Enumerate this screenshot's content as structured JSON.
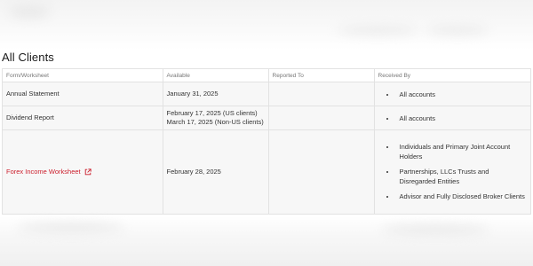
{
  "section": {
    "title": "All Clients"
  },
  "table": {
    "headers": [
      "Form/Worksheet",
      "Available",
      "Reported To",
      "Received By"
    ],
    "rows": [
      {
        "form": "Annual Statement",
        "available": [
          "January 31, 2025"
        ],
        "reported_to": "",
        "received_by": [
          "All accounts"
        ]
      },
      {
        "form": "Dividend Report",
        "available": [
          "February 17, 2025 (US clients)",
          "March 17, 2025 (Non-US clients)"
        ],
        "reported_to": "",
        "received_by": [
          "All accounts"
        ]
      },
      {
        "form": "Forex Income Worksheet",
        "form_is_link": true,
        "form_icon": "external-link-icon",
        "available": [
          "February 28, 2025"
        ],
        "reported_to": "",
        "received_by": [
          "Individuals and Primary Joint Account Holders",
          "Partnerships, LLCs Trusts and Disregarded Entities",
          "Advisor and Fully Disclosed Broker Clients"
        ]
      }
    ]
  },
  "colors": {
    "link": "#cc1f2d",
    "border": "#e2e2e2",
    "row_bg": "#f7f7f7"
  }
}
